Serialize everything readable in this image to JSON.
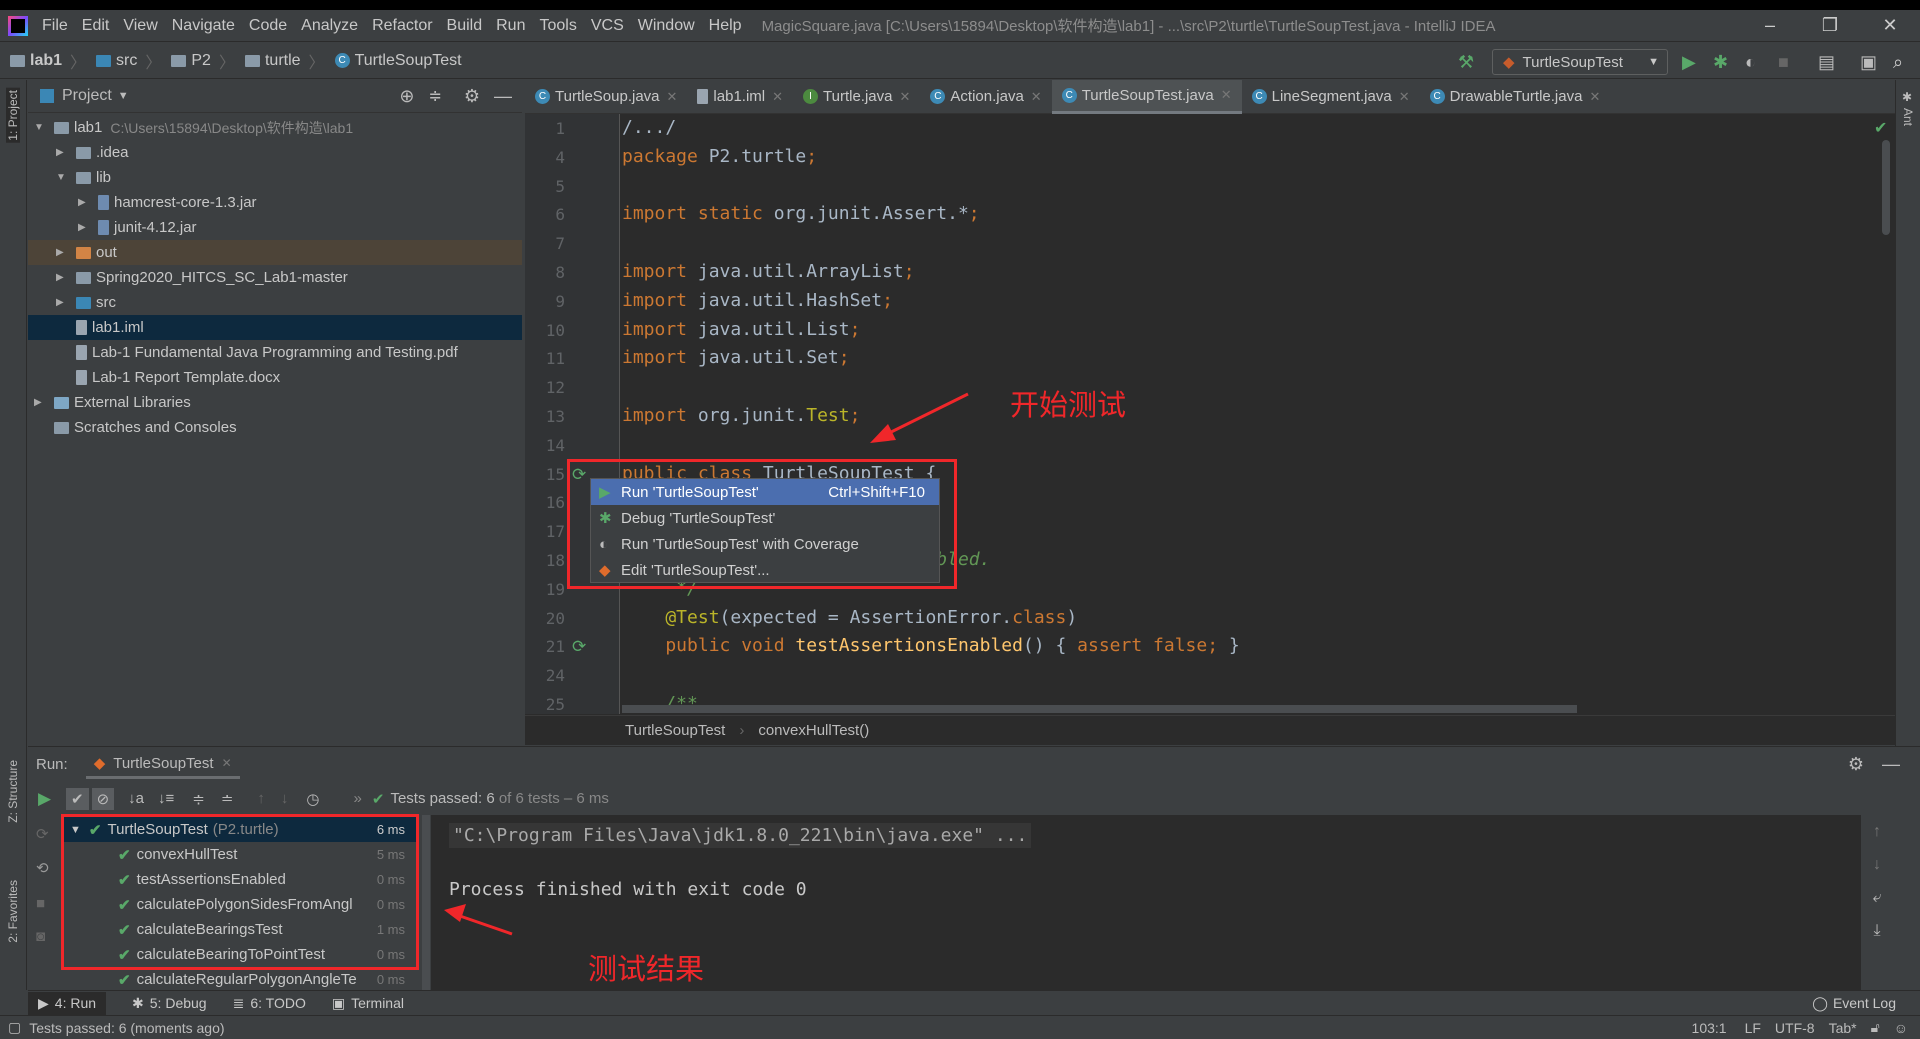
{
  "menubar": {
    "items": [
      "File",
      "Edit",
      "View",
      "Navigate",
      "Code",
      "Analyze",
      "Refactor",
      "Build",
      "Run",
      "Tools",
      "VCS",
      "Window",
      "Help"
    ],
    "title": "MagicSquare.java [C:\\Users\\15894\\Desktop\\软件构造\\lab1] - ...\\src\\P2\\turtle\\TurtleSoupTest.java - IntelliJ IDEA"
  },
  "breadcrumb": [
    "lab1",
    "src",
    "P2",
    "turtle",
    "TurtleSoupTest"
  ],
  "run_config": "TurtleSoupTest",
  "stripe": {
    "project": "1: Project",
    "structure": "Z: Structure",
    "favorites": "2: Favorites",
    "ant": "Ant"
  },
  "project": {
    "title": "Project",
    "items": [
      {
        "label": "lab1",
        "path": "C:\\Users\\15894\\Desktop\\软件构造\\lab1",
        "level": 0,
        "arrow": "▼",
        "icon": "module-folder"
      },
      {
        "label": ".idea",
        "level": 1,
        "arrow": "▶",
        "icon": "folder"
      },
      {
        "label": "lib",
        "level": 1,
        "arrow": "▼",
        "icon": "folder"
      },
      {
        "label": "hamcrest-core-1.3.jar",
        "level": 2,
        "arrow": "▶",
        "icon": "jar"
      },
      {
        "label": "junit-4.12.jar",
        "level": 2,
        "arrow": "▶",
        "icon": "jar"
      },
      {
        "label": "out",
        "level": 1,
        "arrow": "▶",
        "icon": "excluded-folder",
        "state": "excluded"
      },
      {
        "label": "Spring2020_HITCS_SC_Lab1-master",
        "level": 1,
        "arrow": "▶",
        "icon": "folder"
      },
      {
        "label": "src",
        "level": 1,
        "arrow": "▶",
        "icon": "source-folder"
      },
      {
        "label": "lab1.iml",
        "level": 1,
        "arrow": "",
        "icon": "file",
        "state": "selected"
      },
      {
        "label": "Lab-1 Fundamental Java Programming and Testing.pdf",
        "level": 1,
        "arrow": "",
        "icon": "file"
      },
      {
        "label": "Lab-1 Report Template.docx",
        "level": 1,
        "arrow": "",
        "icon": "file"
      },
      {
        "label": "External Libraries",
        "level": 0,
        "arrow": "▶",
        "icon": "library"
      },
      {
        "label": "Scratches and Consoles",
        "level": 0,
        "arrow": "",
        "icon": "scratches"
      }
    ]
  },
  "tabs": [
    {
      "label": "TurtleSoup.java",
      "icon": "C"
    },
    {
      "label": "lab1.iml",
      "icon": "file"
    },
    {
      "label": "Turtle.java",
      "icon": "I"
    },
    {
      "label": "Action.java",
      "icon": "C"
    },
    {
      "label": "TurtleSoupTest.java",
      "icon": "C",
      "active": true
    },
    {
      "label": "LineSegment.java",
      "icon": "C"
    },
    {
      "label": "DrawableTurtle.java",
      "icon": "C"
    }
  ],
  "code": [
    {
      "n": "1",
      "t": [
        [
          "/.../",
          "pl"
        ]
      ]
    },
    {
      "n": "4",
      "t": [
        [
          "package ",
          "kw"
        ],
        [
          "P2.turtle",
          "pl"
        ],
        [
          ";",
          "kw"
        ]
      ]
    },
    {
      "n": "5",
      "t": []
    },
    {
      "n": "6",
      "t": [
        [
          "import static ",
          "kw"
        ],
        [
          "org.junit.Assert.*",
          "pl"
        ],
        [
          ";",
          "kw"
        ]
      ]
    },
    {
      "n": "7",
      "t": []
    },
    {
      "n": "8",
      "t": [
        [
          "import ",
          "kw"
        ],
        [
          "java.util.ArrayList",
          "pl"
        ],
        [
          ";",
          "kw"
        ]
      ]
    },
    {
      "n": "9",
      "t": [
        [
          "import ",
          "kw"
        ],
        [
          "java.util.HashSet",
          "pl"
        ],
        [
          ";",
          "kw"
        ]
      ]
    },
    {
      "n": "10",
      "t": [
        [
          "import ",
          "kw"
        ],
        [
          "java.util.List",
          "pl"
        ],
        [
          ";",
          "kw"
        ]
      ]
    },
    {
      "n": "11",
      "t": [
        [
          "import ",
          "kw"
        ],
        [
          "java.util.Set",
          "pl"
        ],
        [
          ";",
          "kw"
        ]
      ]
    },
    {
      "n": "12",
      "t": []
    },
    {
      "n": "13",
      "t": [
        [
          "import ",
          "kw"
        ],
        [
          "org.junit.",
          "pl"
        ],
        [
          "Test",
          "an"
        ],
        [
          ";",
          "kw"
        ]
      ]
    },
    {
      "n": "14",
      "t": []
    },
    {
      "n": "15",
      "t": [
        [
          "public class ",
          "kw"
        ],
        [
          "TurtleSoupTest {",
          "pl"
        ]
      ]
    },
    {
      "n": "16",
      "t": []
    },
    {
      "n": "17",
      "t": []
    },
    {
      "n": "18",
      "t": [
        [
          "                      are enabled.",
          "cm"
        ]
      ]
    },
    {
      "n": "19",
      "t": [
        [
          "     */",
          "cm"
        ]
      ]
    },
    {
      "n": "20",
      "t": [
        [
          "    @Test",
          "an"
        ],
        [
          "(expected = AssertionError.",
          "pl"
        ],
        [
          "class",
          "kw"
        ],
        [
          ")",
          "pl"
        ]
      ]
    },
    {
      "n": "21",
      "t": [
        [
          "    public void ",
          "kw"
        ],
        [
          "testAssertionsEnabled",
          "fn"
        ],
        [
          "() { ",
          "pl"
        ],
        [
          "assert false;",
          "kw"
        ],
        [
          " }",
          "pl"
        ]
      ]
    },
    {
      "n": "24",
      "t": []
    },
    {
      "n": "25",
      "t": [
        [
          "    /**",
          "cm"
        ]
      ]
    }
  ],
  "editor_breadcrumb": [
    "TurtleSoupTest",
    "convexHullTest()"
  ],
  "popup": {
    "items": [
      {
        "label": "Run 'TurtleSoupTest'",
        "shortcut": "Ctrl+Shift+F10",
        "icon": "run"
      },
      {
        "label": "Debug 'TurtleSoupTest'",
        "icon": "debug"
      },
      {
        "label": "Run 'TurtleSoupTest' with Coverage",
        "icon": "coverage"
      },
      {
        "label": "Edit 'TurtleSoupTest'...",
        "icon": "edit-config"
      }
    ]
  },
  "annotations": {
    "start_test": "开始测试",
    "test_result": "测试结果"
  },
  "run": {
    "label": "Run:",
    "tab": "TurtleSoupTest",
    "summary_prefix": "Tests passed:",
    "summary_count": "6",
    "summary_rest": "of 6 tests – 6 ms",
    "tests": [
      {
        "name": "TurtleSoupTest",
        "pkg": "(P2.turtle)",
        "time": "6 ms",
        "root": true
      },
      {
        "name": "convexHullTest",
        "time": "5 ms"
      },
      {
        "name": "testAssertionsEnabled",
        "time": "0 ms"
      },
      {
        "name": "calculatePolygonSidesFromAngl",
        "time": "0 ms"
      },
      {
        "name": "calculateBearingsTest",
        "time": "1 ms"
      },
      {
        "name": "calculateBearingToPointTest",
        "time": "0 ms"
      },
      {
        "name": "calculateRegularPolygonAngleTe",
        "time": "0 ms"
      }
    ],
    "console": [
      "\"C:\\Program Files\\Java\\jdk1.8.0_221\\bin\\java.exe\" ...",
      "Process finished with exit code 0"
    ]
  },
  "bottom_tabs": [
    "4: Run",
    "5: Debug",
    "6: TODO",
    "Terminal"
  ],
  "event_log": "Event Log",
  "status": {
    "message": "Tests passed: 6 (moments ago)",
    "position": "103:1",
    "line_sep": "LF",
    "encoding": "UTF-8",
    "indent": "Tab*"
  }
}
